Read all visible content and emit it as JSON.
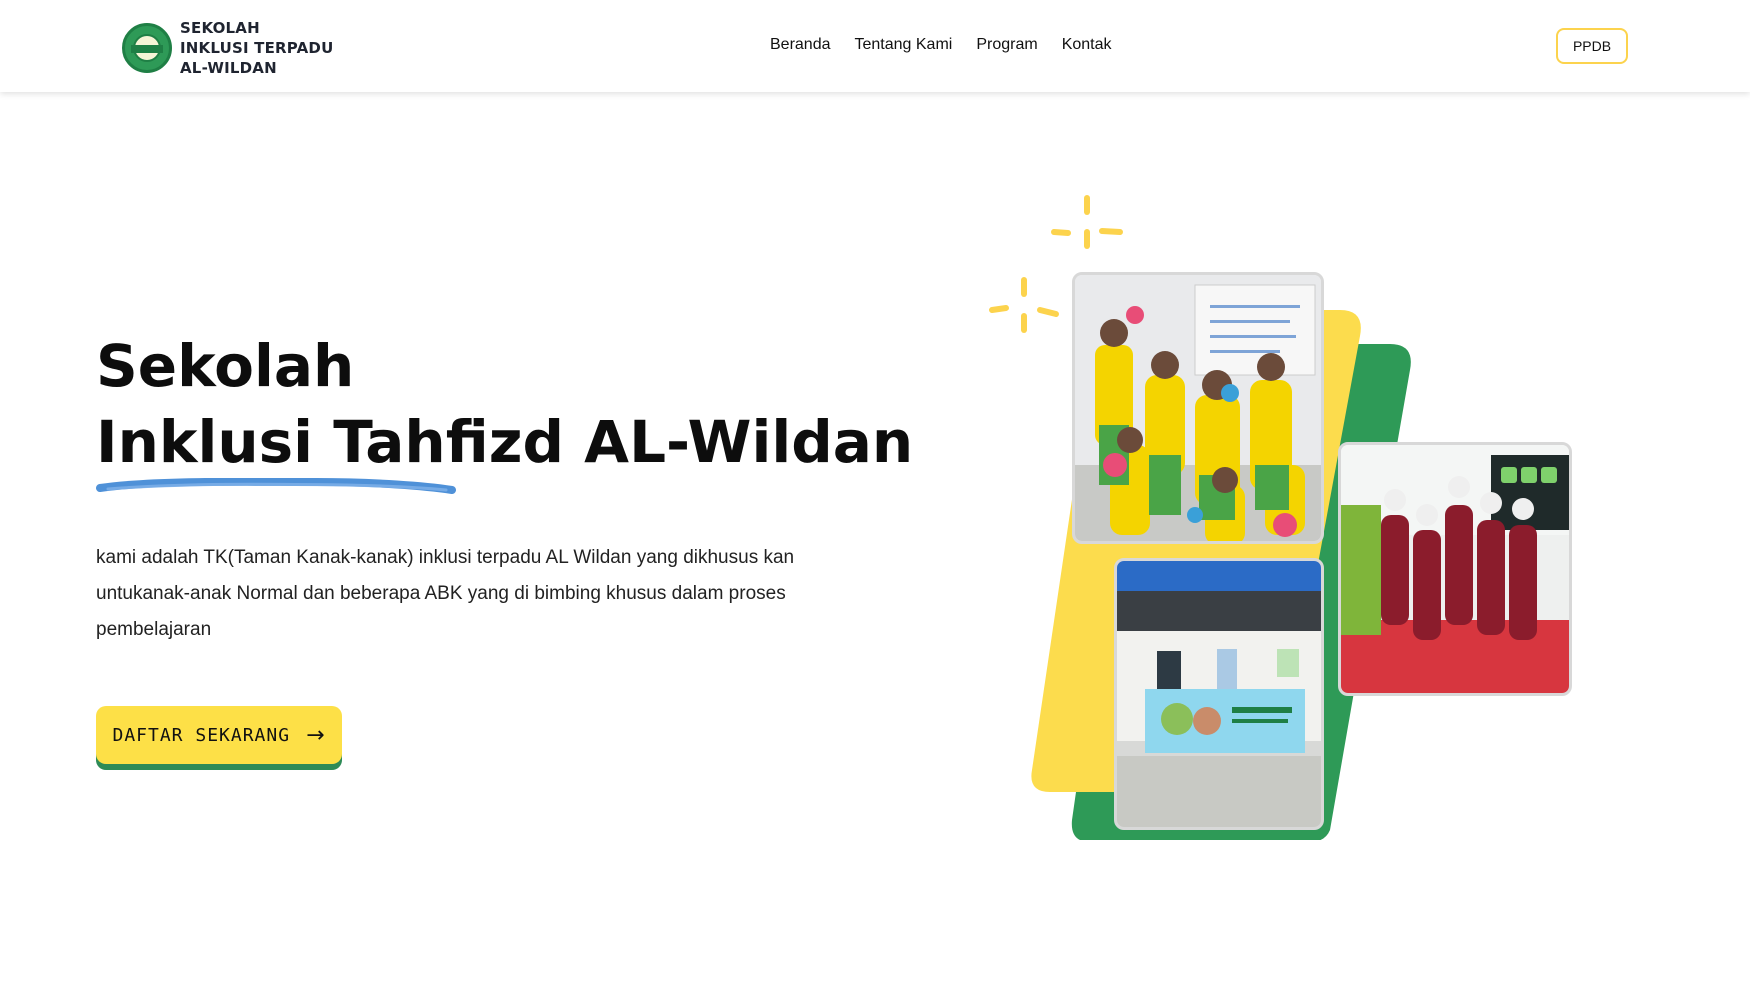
{
  "header": {
    "brand_lines": [
      "SEKOLAH",
      "INKLUSI TERPADU",
      "AL-WILDAN"
    ],
    "nav": [
      "Beranda",
      "Tentang Kami",
      "Program",
      "Kontak"
    ],
    "ppdb_label": "PPDB"
  },
  "hero": {
    "title_line1": "Sekolah",
    "title_line2": "Inklusi Tahfizd AL-Wildan",
    "description": "kami adalah TK(Taman Kanak-kanak) inklusi terpadu AL Wildan yang dikhusus kan untukanak-anak Normal dan beberapa ABK yang di bimbing khusus dalam proses pembelajaran",
    "cta_label": "DAFTAR SEKARANG"
  },
  "colors": {
    "accent_yellow": "#fde047",
    "accent_green": "#2e8b57",
    "underline_blue": "#4f91d8"
  },
  "photos": [
    {
      "name": "children-with-pinwheels-photo"
    },
    {
      "name": "children-praying-photo"
    },
    {
      "name": "school-building-photo"
    }
  ]
}
